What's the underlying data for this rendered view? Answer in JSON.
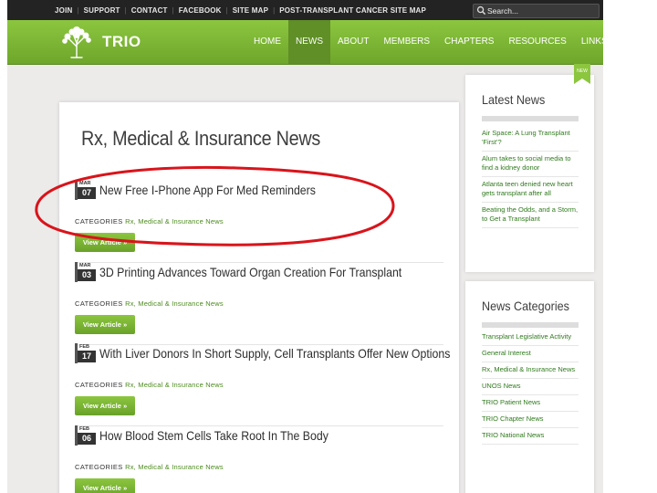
{
  "top_links": [
    "JOIN",
    "SUPPORT",
    "CONTACT",
    "FACEBOOK",
    "SITE MAP",
    "POST-TRANSPLANT CANCER SITE MAP"
  ],
  "search": {
    "placeholder": "Search...",
    "icon": "search-icon"
  },
  "brand": {
    "name": "TRIO",
    "logo_icon": "tree-logo-icon"
  },
  "nav": {
    "items": [
      "HOME",
      "NEWS",
      "ABOUT",
      "MEMBERS",
      "CHAPTERS",
      "RESOURCES",
      "LINKS"
    ],
    "active": "NEWS"
  },
  "page_title": "Rx, Medical & Insurance News",
  "posts": [
    {
      "month": "MAR",
      "day": "07",
      "title": "New Free I-Phone App For Med Reminders",
      "categories_label": "CATEGORIES",
      "category": "Rx, Medical & Insurance News",
      "button": "View Article »"
    },
    {
      "month": "MAR",
      "day": "03",
      "title": "3D Printing Advances Toward Organ Creation For Transplant",
      "categories_label": "CATEGORIES",
      "category": "Rx, Medical & Insurance News",
      "button": "View Article »"
    },
    {
      "month": "FEB",
      "day": "17",
      "title": "With Liver Donors In Short Supply, Cell Transplants Offer New Options",
      "categories_label": "CATEGORIES",
      "category": "Rx, Medical & Insurance News",
      "button": "View Article »"
    },
    {
      "month": "FEB",
      "day": "06",
      "title": "How Blood Stem Cells Take Root In The Body",
      "categories_label": "CATEGORIES",
      "category": "Rx, Medical & Insurance News",
      "button": "View Article »"
    }
  ],
  "latest_news": {
    "title": "Latest News",
    "badge": "NEW",
    "items": [
      "Air Space: A Lung Transplant 'First'?",
      "Alum takes to social media to find a kidney donor",
      "Atlanta teen denied new heart gets transplant after all",
      "Beating the Odds, and a Storm, to Get a Transplant"
    ]
  },
  "news_categories": {
    "title": "News Categories",
    "items": [
      "Transplant Legislative Activity",
      "General Interest",
      "Rx, Medical & Insurance News",
      "UNOS News",
      "TRIO Patient News",
      "TRIO Chapter News",
      "TRIO National News"
    ]
  },
  "colors": {
    "accent": "#7bb536",
    "link": "#2f7a1c",
    "highlight": "#d9141b",
    "topbar": "#232323"
  }
}
